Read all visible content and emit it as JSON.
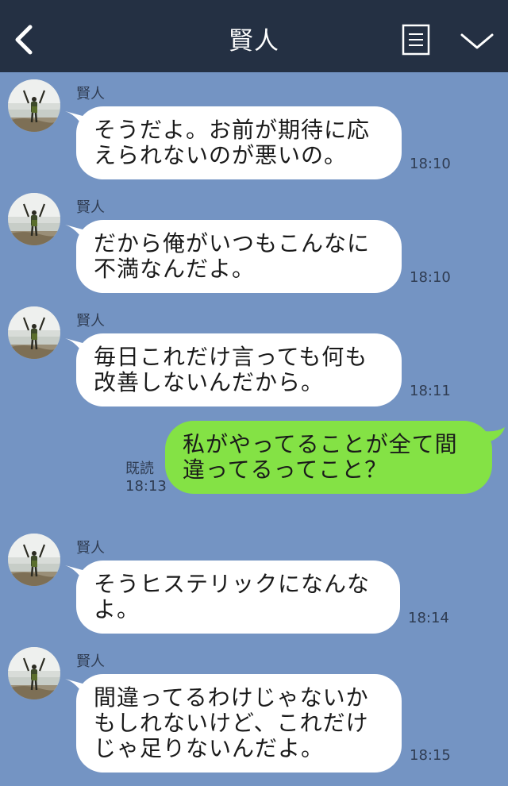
{
  "header": {
    "title": "賢人"
  },
  "colors": {
    "background": "#7494c3",
    "header": "#243043",
    "outgoing_bubble": "#84e245",
    "incoming_bubble": "#ffffff"
  },
  "messages": [
    {
      "sender": "賢人",
      "lines": [
        "そうだよ。お前が期待に応",
        "えられないのが悪いの。"
      ],
      "time": "18:10"
    },
    {
      "sender": "賢人",
      "lines": [
        "だから俺がいつもこんなに",
        "不満なんだよ。"
      ],
      "time": "18:10"
    },
    {
      "sender": "賢人",
      "lines": [
        "毎日これだけ言っても何も",
        "改善しないんだから。"
      ],
      "time": "18:11"
    },
    {
      "read": "既読",
      "lines": [
        "私がやってることが全て間",
        "違ってるってこと？"
      ],
      "time": "18:13"
    },
    {
      "sender": "賢人",
      "lines": [
        "そうヒステリックになんな",
        "よ。"
      ],
      "time": "18:14"
    },
    {
      "sender": "賢人",
      "lines": [
        "間違ってるわけじゃないか",
        "もしれないけど、これだけ",
        "じゃ足りないんだよ。"
      ],
      "time": "18:15"
    }
  ]
}
